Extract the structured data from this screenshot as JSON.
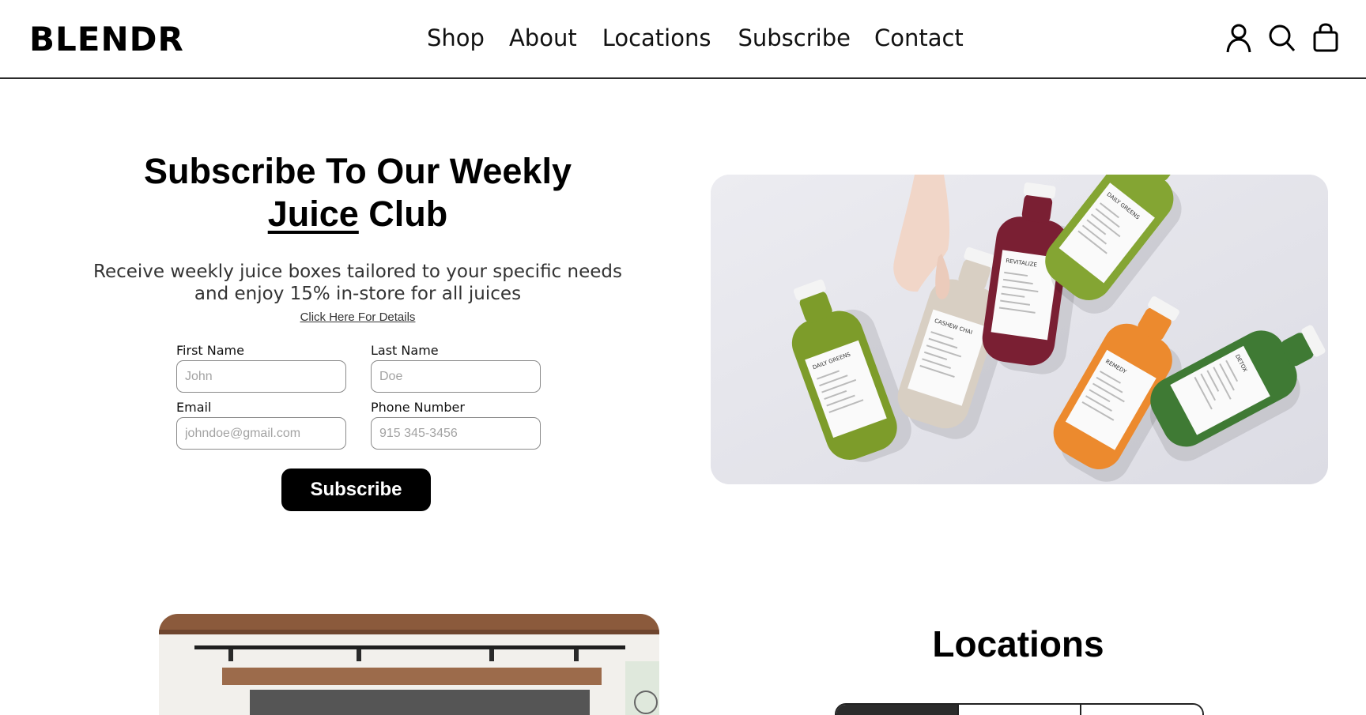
{
  "brand": {
    "logo": "BLENDR"
  },
  "nav": {
    "items": [
      "Shop",
      "About",
      "Locations",
      "Subscribe",
      "Contact"
    ]
  },
  "header_icons": [
    "account-icon",
    "search-icon",
    "shopping-bag-icon"
  ],
  "subscribe_section": {
    "title_line1": "Subscribe To Our Weekly",
    "title_highlight": "Juice",
    "title_rest": " Club",
    "description": "Receive weekly juice boxes tailored to your specific needs and enjoy 15% in-store for all juices",
    "details_link": "Click Here For Details",
    "form": {
      "first_name": {
        "label": "First Name",
        "placeholder": "John"
      },
      "last_name": {
        "label": "Last Name",
        "placeholder": "Doe"
      },
      "email": {
        "label": "Email",
        "placeholder": "johndoe@gmail.com"
      },
      "phone": {
        "label": "Phone Number",
        "placeholder": "915 345-3456"
      }
    },
    "submit_label": "Subscribe"
  },
  "hero_image": {
    "bottle_labels": [
      "DAILY GREENS",
      "CASHEW CHAI",
      "REVITALIZE",
      "DAILY GREENS",
      "REMEDY",
      "DETOX"
    ],
    "bottle_colors": [
      "#7d9c2a",
      "#d8cfc3",
      "#7a1f33",
      "#84a533",
      "#ec8a2e",
      "#3f7a34"
    ]
  },
  "locations_section": {
    "title": "Locations"
  },
  "colors": {
    "text": "#000000",
    "button_bg": "#000000",
    "button_text": "#ffffff",
    "header_border": "#2b2b2b"
  }
}
